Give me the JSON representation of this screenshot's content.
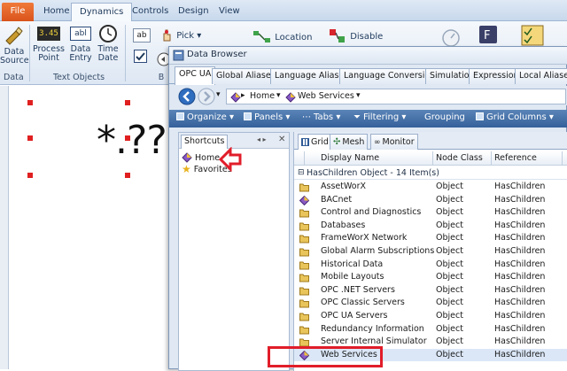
{
  "ribbon": {
    "tabs": [
      "File",
      "Home",
      "Dynamics",
      "Controls",
      "Design",
      "View"
    ],
    "active_tab": "Dynamics",
    "buttons": {
      "data_source": "Data Source",
      "process_point": "Process Point",
      "data_entry": "Data Entry",
      "time_date": "Time Date",
      "pick": "Pick",
      "location": "Location",
      "disable": "Disable"
    },
    "icon_labels": {
      "process_point": "3.45",
      "data_entry": "abl",
      "text_ab": "ab"
    },
    "groups": {
      "data": "Data",
      "text_objects": "Text Objects",
      "b": "B"
    }
  },
  "canvas": {
    "text": "*.??"
  },
  "browser": {
    "title": "Data Browser",
    "tabs": [
      "OPC UA",
      "Global Aliases",
      "Language Aliases",
      "Language Conversions",
      "Simulation",
      "Expression",
      "Local Aliases"
    ],
    "active_tab": "OPC UA",
    "breadcrumb": [
      "Home",
      "Web Services"
    ],
    "toolbar": [
      "Organize",
      "Panels",
      "Tabs",
      "Filtering",
      "Grouping",
      "Grid Columns"
    ],
    "shortcuts": {
      "tab": "Shortcuts",
      "items": [
        "Home",
        "Favorites"
      ]
    },
    "grid": {
      "tabs": [
        "Grid",
        "Mesh",
        "Monitor"
      ],
      "active_tab": "Grid",
      "columns": [
        "Display Name",
        "Node Class",
        "Reference"
      ],
      "group_label": "HasChildren Object - 14 Item(s)",
      "rows": [
        {
          "name": "AssetWorX",
          "class": "Object",
          "ref": "HasChildren",
          "icon": "folder"
        },
        {
          "name": "BACnet",
          "class": "Object",
          "ref": "HasChildren",
          "icon": "diamond"
        },
        {
          "name": "Control and Diagnostics",
          "class": "Object",
          "ref": "HasChildren",
          "icon": "folder"
        },
        {
          "name": "Databases",
          "class": "Object",
          "ref": "HasChildren",
          "icon": "folder"
        },
        {
          "name": "FrameWorX Network",
          "class": "Object",
          "ref": "HasChildren",
          "icon": "folder"
        },
        {
          "name": "Global Alarm Subscriptions",
          "class": "Object",
          "ref": "HasChildren",
          "icon": "folder"
        },
        {
          "name": "Historical Data",
          "class": "Object",
          "ref": "HasChildren",
          "icon": "folder"
        },
        {
          "name": "Mobile Layouts",
          "class": "Object",
          "ref": "HasChildren",
          "icon": "folder"
        },
        {
          "name": "OPC .NET Servers",
          "class": "Object",
          "ref": "HasChildren",
          "icon": "folder"
        },
        {
          "name": "OPC Classic Servers",
          "class": "Object",
          "ref": "HasChildren",
          "icon": "folder"
        },
        {
          "name": "OPC UA Servers",
          "class": "Object",
          "ref": "HasChildren",
          "icon": "folder"
        },
        {
          "name": "Redundancy Information",
          "class": "Object",
          "ref": "HasChildren",
          "icon": "folder"
        },
        {
          "name": "Server Internal Simulator",
          "class": "Object",
          "ref": "HasChildren",
          "icon": "folder"
        },
        {
          "name": "Web Services",
          "class": "Object",
          "ref": "HasChildren",
          "icon": "diamond"
        }
      ]
    }
  },
  "colors": {
    "annotation_red": "#e11d2a",
    "toolbar_blue": "#3f6aa3",
    "file_tab_orange": "#e4632a"
  }
}
